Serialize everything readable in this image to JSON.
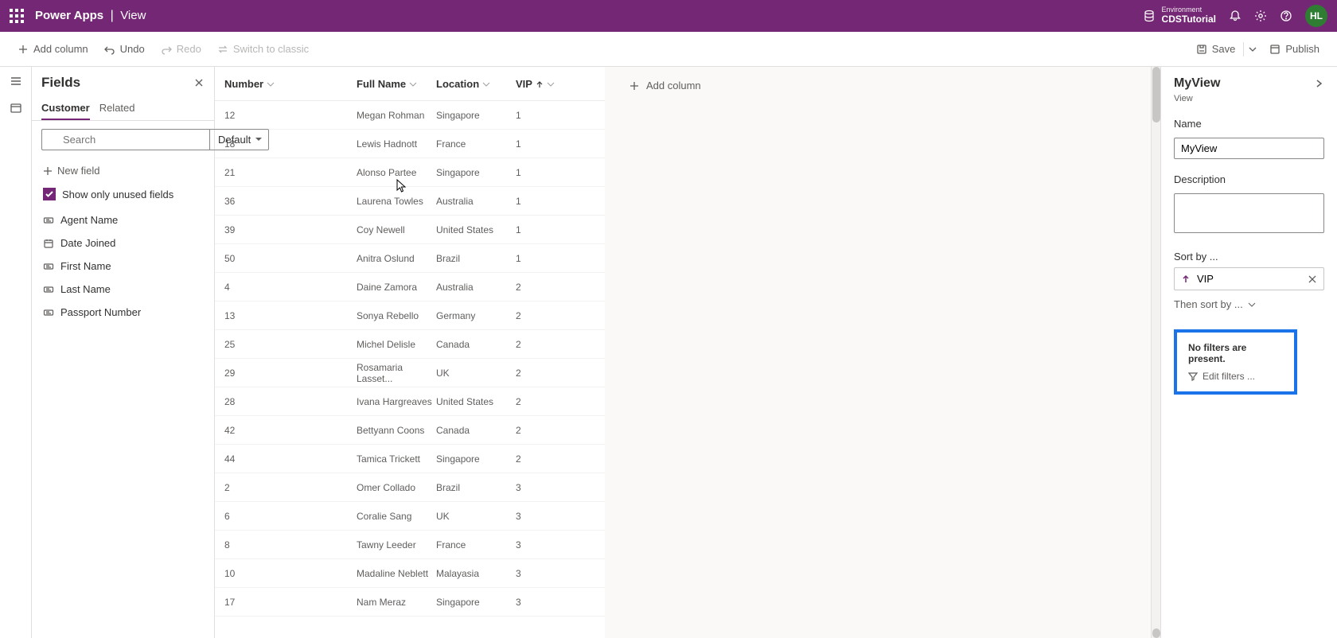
{
  "appBar": {
    "title": "Power Apps",
    "subtitle": "View",
    "envLabel": "Environment",
    "envName": "CDSTutorial",
    "avatar": "HL"
  },
  "cmdBar": {
    "addColumn": "Add column",
    "undo": "Undo",
    "redo": "Redo",
    "switch": "Switch to classic",
    "save": "Save",
    "publish": "Publish"
  },
  "fieldsPanel": {
    "title": "Fields",
    "tabCustomer": "Customer",
    "tabRelated": "Related",
    "searchPlaceholder": "Search",
    "defaultLabel": "Default",
    "newField": "New field",
    "showUnused": "Show only unused fields",
    "fields": [
      {
        "label": "Agent Name",
        "type": "text"
      },
      {
        "label": "Date Joined",
        "type": "date"
      },
      {
        "label": "First Name",
        "type": "text"
      },
      {
        "label": "Last Name",
        "type": "text"
      },
      {
        "label": "Passport Number",
        "type": "text"
      }
    ]
  },
  "grid": {
    "cols": {
      "number": "Number",
      "fullName": "Full Name",
      "location": "Location",
      "vip": "VIP"
    },
    "addColumn": "Add column",
    "rows": [
      {
        "n": "12",
        "name": "Megan Rohman",
        "loc": "Singapore",
        "vip": "1"
      },
      {
        "n": "18",
        "name": "Lewis Hadnott",
        "loc": "France",
        "vip": "1"
      },
      {
        "n": "21",
        "name": "Alonso Partee",
        "loc": "Singapore",
        "vip": "1"
      },
      {
        "n": "36",
        "name": "Laurena Towles",
        "loc": "Australia",
        "vip": "1"
      },
      {
        "n": "39",
        "name": "Coy Newell",
        "loc": "United States",
        "vip": "1"
      },
      {
        "n": "50",
        "name": "Anitra Oslund",
        "loc": "Brazil",
        "vip": "1"
      },
      {
        "n": "4",
        "name": "Daine Zamora",
        "loc": "Australia",
        "vip": "2"
      },
      {
        "n": "13",
        "name": "Sonya Rebello",
        "loc": "Germany",
        "vip": "2"
      },
      {
        "n": "25",
        "name": "Michel Delisle",
        "loc": "Canada",
        "vip": "2"
      },
      {
        "n": "29",
        "name": "Rosamaria Lasset...",
        "loc": "UK",
        "vip": "2"
      },
      {
        "n": "28",
        "name": "Ivana Hargreaves",
        "loc": "United States",
        "vip": "2"
      },
      {
        "n": "42",
        "name": "Bettyann Coons",
        "loc": "Canada",
        "vip": "2"
      },
      {
        "n": "44",
        "name": "Tamica Trickett",
        "loc": "Singapore",
        "vip": "2"
      },
      {
        "n": "2",
        "name": "Omer Collado",
        "loc": "Brazil",
        "vip": "3"
      },
      {
        "n": "6",
        "name": "Coralie Sang",
        "loc": "UK",
        "vip": "3"
      },
      {
        "n": "8",
        "name": "Tawny Leeder",
        "loc": "France",
        "vip": "3"
      },
      {
        "n": "10",
        "name": "Madaline Neblett",
        "loc": "Malayasia",
        "vip": "3"
      },
      {
        "n": "17",
        "name": "Nam Meraz",
        "loc": "Singapore",
        "vip": "3"
      }
    ]
  },
  "props": {
    "title": "MyView",
    "subtitle": "View",
    "nameLabel": "Name",
    "nameValue": "MyView",
    "descLabel": "Description",
    "descValue": "",
    "sortByLabel": "Sort by ...",
    "sortField": "VIP",
    "thenSort": "Then sort by ...",
    "noFilters": "No filters are present.",
    "editFilters": "Edit filters ..."
  }
}
